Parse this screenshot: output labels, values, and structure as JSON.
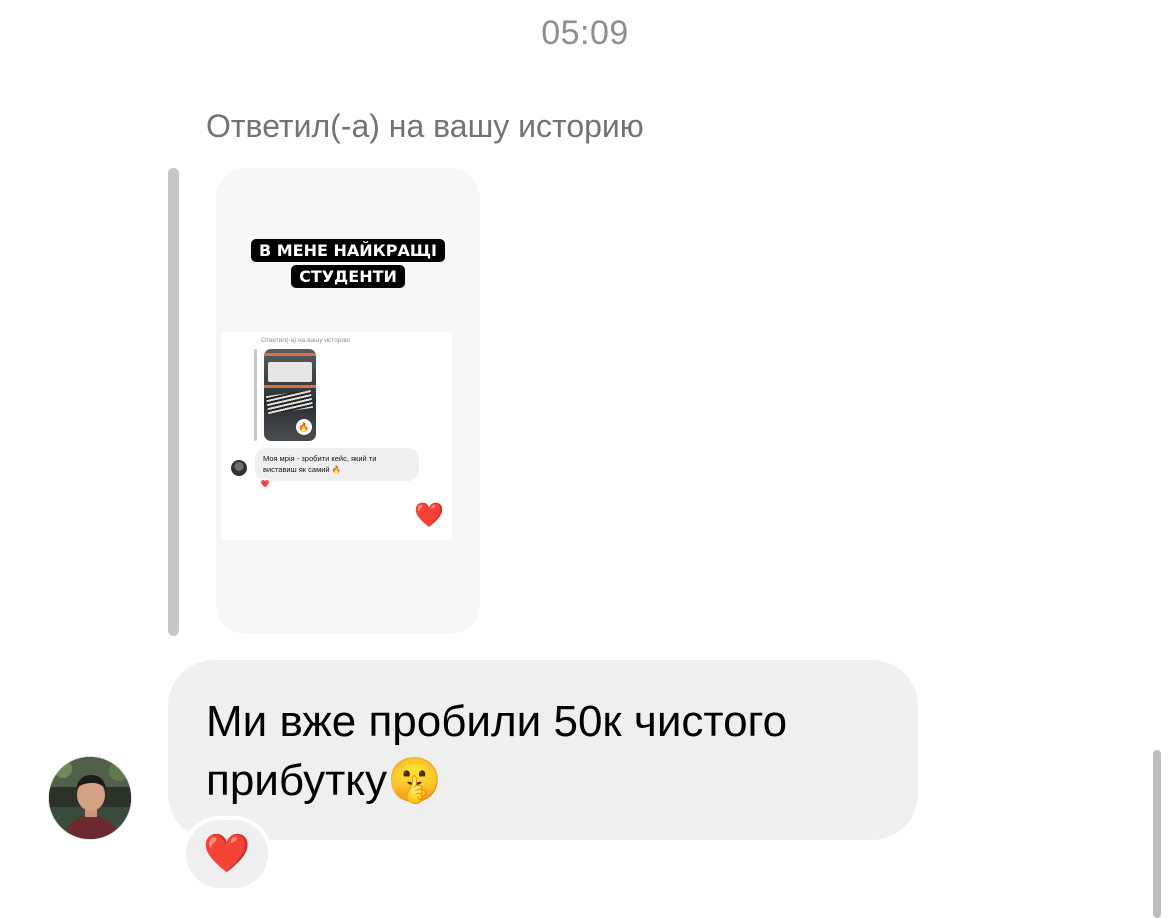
{
  "chat": {
    "timestamp": "05:09",
    "reply_label": "Ответил(-а) на вашу историю",
    "story": {
      "title_line1": "В МЕНЕ НАЙКРАЩІ",
      "title_line2": "СТУДЕНТИ",
      "embedded": {
        "reply_label": "Ответил(-а) на вашу историю",
        "message": "Моя мрія - зробити кейс, який ти виставиш як самий 🔥",
        "reaction": "❤️",
        "heart": "❤️"
      }
    },
    "message": {
      "text": "Ми вже пробили 50к чистого прибутку",
      "emoji": "🤫"
    },
    "reaction": "❤️"
  },
  "colors": {
    "bubble_bg": "#efefef",
    "muted_text": "#8e8e8e",
    "quote_bar": "#c7c7c7"
  },
  "icons": [
    "heart-icon",
    "fire-icon",
    "shushing-face-emoji"
  ]
}
